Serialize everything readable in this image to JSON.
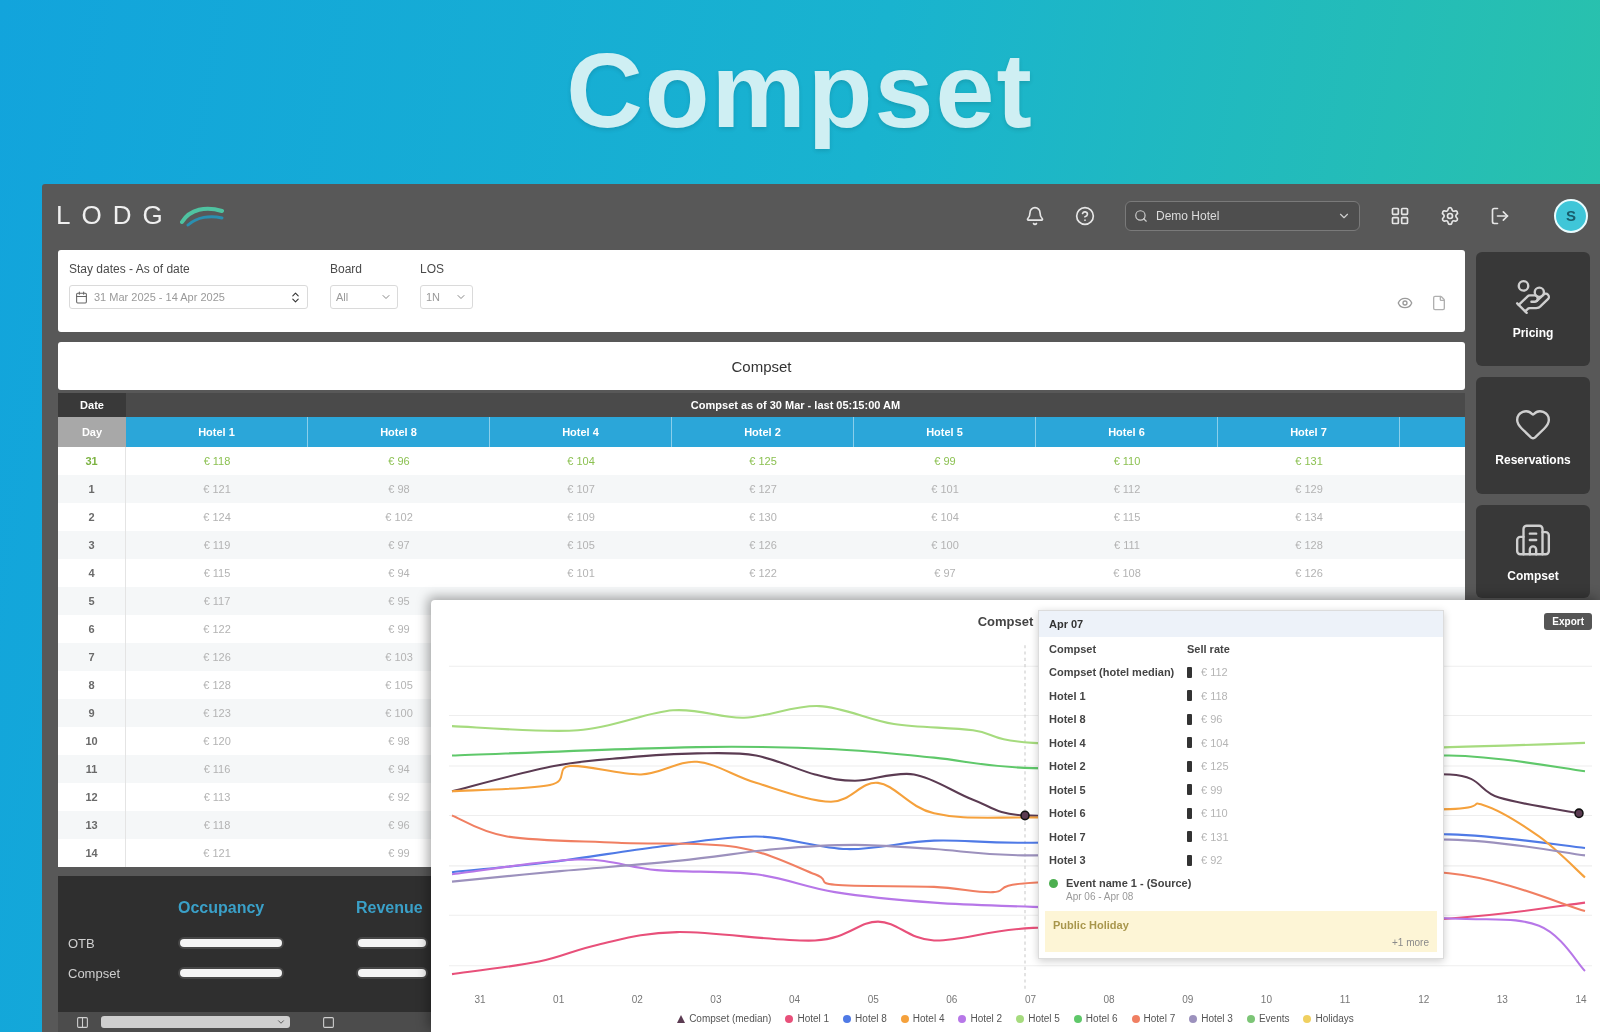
{
  "banner": {
    "title": "Compset"
  },
  "topbar": {
    "logo": "LODG",
    "hotel_select": "Demo Hotel",
    "avatar": "S"
  },
  "filters": [
    {
      "kind": "daterange",
      "label": "Stay dates - As of date",
      "value": "31 Mar 2025 - 14 Apr 2025"
    },
    {
      "kind": "select",
      "label": "Board",
      "value": "All"
    },
    {
      "kind": "select",
      "label": "LOS",
      "value": "1N"
    }
  ],
  "section_title": "Compset",
  "table": {
    "corner": "Date",
    "caption": "Compset as of 30 Mar - last 05:15:00 AM",
    "first_column": "Day",
    "columns": [
      "Hotel 1",
      "Hotel 8",
      "Hotel 4",
      "Hotel 2",
      "Hotel 5",
      "Hotel 6",
      "Hotel 7"
    ],
    "rows": [
      {
        "date": "31",
        "highlighted": true,
        "cells": [
          "€ 118",
          "€ 96",
          "€ 104",
          "€ 125",
          "€ 99",
          "€ 110",
          "€ 131"
        ]
      },
      {
        "date": "1",
        "highlighted": false,
        "cells": [
          "€ 121",
          "€ 98",
          "€ 107",
          "€ 127",
          "€ 101",
          "€ 112",
          "€ 129"
        ]
      },
      {
        "date": "2",
        "highlighted": false,
        "cells": [
          "€ 124",
          "€ 102",
          "€ 109",
          "€ 130",
          "€ 104",
          "€ 115",
          "€ 134"
        ]
      },
      {
        "date": "3",
        "highlighted": false,
        "cells": [
          "€ 119",
          "€ 97",
          "€ 105",
          "€ 126",
          "€ 100",
          "€ 111",
          "€ 128"
        ]
      },
      {
        "date": "4",
        "highlighted": false,
        "cells": [
          "€ 115",
          "€ 94",
          "€ 101",
          "€ 122",
          "€ 97",
          "€ 108",
          "€ 126"
        ]
      },
      {
        "date": "5",
        "highlighted": false,
        "cells": [
          "€ 117",
          "€ 95"
        ]
      },
      {
        "date": "6",
        "highlighted": false,
        "cells": [
          "€ 122",
          "€ 99"
        ]
      },
      {
        "date": "7",
        "highlighted": false,
        "cells": [
          "€ 126",
          "€ 103"
        ]
      },
      {
        "date": "8",
        "highlighted": false,
        "cells": [
          "€ 128",
          "€ 105"
        ]
      },
      {
        "date": "9",
        "highlighted": false,
        "cells": [
          "€ 123",
          "€ 100"
        ]
      },
      {
        "date": "10",
        "highlighted": false,
        "cells": [
          "€ 120",
          "€ 98"
        ]
      },
      {
        "date": "11",
        "highlighted": false,
        "cells": [
          "€ 116",
          "€ 94"
        ]
      },
      {
        "date": "12",
        "highlighted": false,
        "cells": [
          "€ 113",
          "€ 92"
        ]
      },
      {
        "date": "13",
        "highlighted": false,
        "cells": [
          "€ 118",
          "€ 96"
        ]
      },
      {
        "date": "14",
        "highlighted": false,
        "cells": [
          "€ 121",
          "€ 99"
        ]
      }
    ]
  },
  "summary": {
    "columns": [
      "Occupancy",
      "Revenue"
    ],
    "rows": [
      {
        "label": "OTB",
        "bars": [
          {
            "level": 1
          },
          {
            "level": 1
          }
        ]
      },
      {
        "label": "Compset",
        "bars": [
          {
            "level": 1
          },
          {
            "level": 1
          }
        ]
      }
    ]
  },
  "sidebar": [
    {
      "label": "Pricing"
    },
    {
      "label": "Reservations"
    },
    {
      "label": "Compset"
    }
  ],
  "chart": {
    "title": "Compset",
    "export": "Export",
    "x_labels": [
      "31",
      "01",
      "02",
      "03",
      "04",
      "05",
      "06",
      "07",
      "08",
      "09",
      "10",
      "11",
      "12",
      "13",
      "14"
    ],
    "legend": [
      {
        "label": "Compset (median)",
        "color": "#5b3b52"
      },
      {
        "label": "Hotel 1",
        "color": "#e8507a"
      },
      {
        "label": "Hotel 8",
        "color": "#4f7ae6"
      },
      {
        "label": "Hotel 4",
        "color": "#f5a13c"
      },
      {
        "label": "Hotel 2",
        "color": "#b777e8"
      },
      {
        "label": "Hotel 5",
        "color": "#a6db7e"
      },
      {
        "label": "Hotel 6",
        "color": "#5fc86a"
      },
      {
        "label": "Hotel 7",
        "color": "#f07f62"
      },
      {
        "label": "Hotel 3",
        "color": "#9c91bd"
      },
      {
        "label": "Events",
        "color": "#7cc576"
      },
      {
        "label": "Holidays",
        "color": "#f0d060"
      }
    ],
    "tooltip": {
      "date": "Apr 07",
      "columns": [
        "Compset",
        "Sell rate"
      ],
      "rows": [
        {
          "name": "Compset (hotel median)",
          "value": "€ 112"
        },
        {
          "name": "Hotel 1",
          "value": "€ 118"
        },
        {
          "name": "Hotel 8",
          "value": "€ 96"
        },
        {
          "name": "Hotel 4",
          "value": "€ 104"
        },
        {
          "name": "Hotel 2",
          "value": "€ 125"
        },
        {
          "name": "Hotel 5",
          "value": "€ 99"
        },
        {
          "name": "Hotel 6",
          "value": "€ 110"
        },
        {
          "name": "Hotel 7",
          "value": "€ 131"
        },
        {
          "name": "Hotel 3",
          "value": "€ 92"
        }
      ],
      "event": {
        "title": "Event name 1 - (Source)",
        "detail": "Apr 06 - Apr 08"
      },
      "holiday": {
        "title": "Public Holiday",
        "more": "+1 more"
      }
    }
  }
}
